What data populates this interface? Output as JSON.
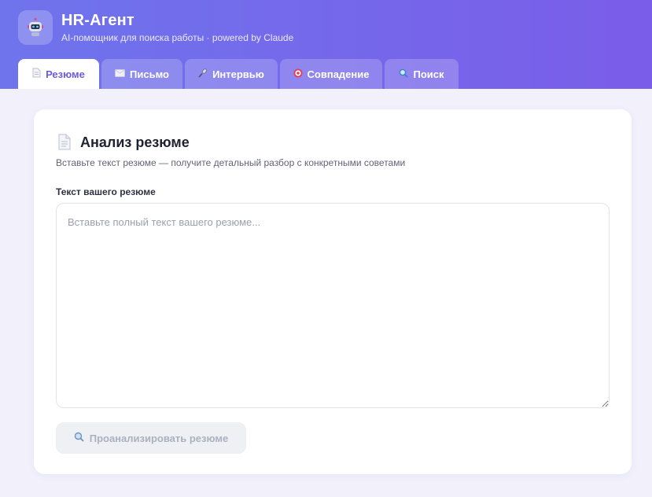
{
  "app": {
    "title": "HR-Агент",
    "subtitle": "AI-помощник для поиска работы · powered by Claude",
    "logo_icon": "robot-icon"
  },
  "tabs": [
    {
      "label": "Резюме",
      "icon": "document-icon",
      "active": true
    },
    {
      "label": "Письмо",
      "icon": "envelope-icon",
      "active": false
    },
    {
      "label": "Интервью",
      "icon": "microphone-icon",
      "active": false
    },
    {
      "label": "Совпадение",
      "icon": "target-icon",
      "active": false
    },
    {
      "label": "Поиск",
      "icon": "magnifier-icon",
      "active": false
    }
  ],
  "card": {
    "icon": "document-icon",
    "title": "Анализ резюме",
    "description": "Вставьте текст резюме — получите детальный разбор с конкретными советами",
    "field_label": "Текст вашего резюме",
    "placeholder": "Вставьте полный текст вашего резюме...",
    "value": "",
    "button_label": "Проанализировать резюме",
    "button_icon": "magnifier-icon"
  },
  "colors": {
    "header_start": "#6f74ec",
    "header_end": "#7a5de9",
    "accent": "#6a5ce0",
    "background": "#f1f0fb",
    "disabled_button": "#eef0f4"
  }
}
